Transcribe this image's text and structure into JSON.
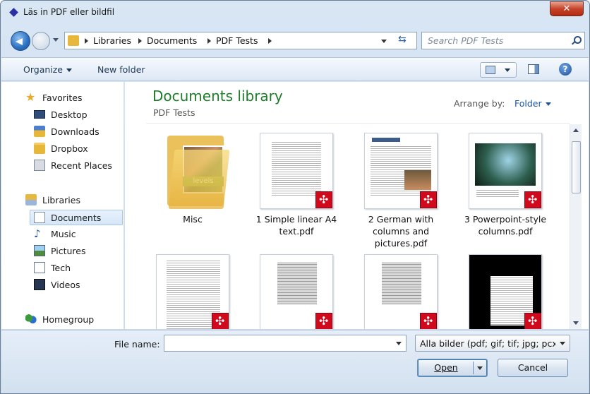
{
  "window": {
    "title": "Läs in PDF eller bildfil",
    "close_label": "✕"
  },
  "nav": {
    "breadcrumbs": [
      "Libraries",
      "Documents",
      "PDF Tests"
    ],
    "search_placeholder": "Search PDF Tests"
  },
  "toolbar": {
    "organize": "Organize",
    "new_folder": "New folder",
    "help": "?"
  },
  "sidebar": {
    "favorites_header": "Favorites",
    "favorites": [
      "Desktop",
      "Downloads",
      "Dropbox",
      "Recent Places"
    ],
    "libraries_header": "Libraries",
    "libraries": [
      "Documents",
      "Music",
      "Pictures",
      "Tech",
      "Videos"
    ],
    "homegroup": "Homegroup",
    "selected": "Documents"
  },
  "content": {
    "title": "Documents library",
    "subtitle": "PDF Tests",
    "arrange_label": "Arrange by:",
    "arrange_value": "Folder",
    "items": [
      {
        "label": "Misc",
        "type": "folder"
      },
      {
        "label": "1 Simple linear A4 text.pdf",
        "type": "pdf"
      },
      {
        "label": "2 German with columns and pictures.pdf",
        "type": "pdf"
      },
      {
        "label": "3 Powerpoint-style columns.pdf",
        "type": "pdf"
      }
    ],
    "folder_band_text": "levels"
  },
  "bottom": {
    "file_name_label": "File name:",
    "file_name_value": "",
    "filter_value": "Alla bilder (pdf; gif; tif; jpg; pcx; png)",
    "open_label": "Open",
    "cancel_label": "Cancel"
  },
  "colors": {
    "accent_green": "#1e7c2a",
    "link_blue": "#1c56a6",
    "pdf_red": "#d1091c"
  }
}
